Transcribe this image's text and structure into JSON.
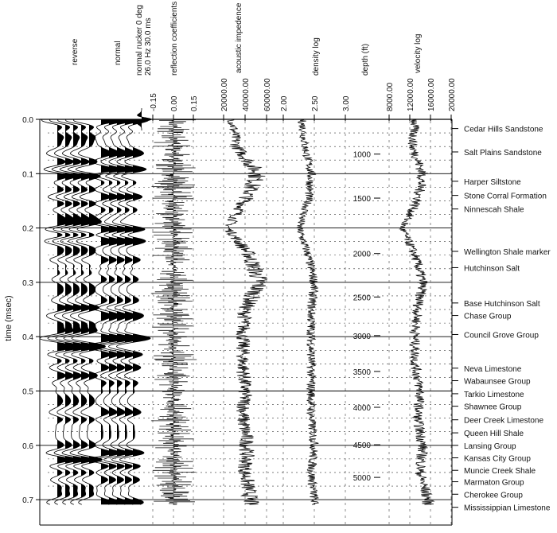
{
  "chart_data": {
    "type": "line",
    "ylabel": "time (msec)",
    "ylim": [
      0.0,
      0.72
    ],
    "time_ticks": [
      "0.0",
      "0.1",
      "0.2",
      "0.3",
      "0.4",
      "0.5",
      "0.6",
      "0.7"
    ],
    "columns": {
      "reverse": "reverse",
      "normal": "normal",
      "wavelet": [
        "normal rucker  0 deg",
        "26.0 Hz",
        "30.0 ms"
      ],
      "reflection": {
        "label": "reflection coefficients",
        "ticks": [
          "-0.15",
          "0.00",
          "0.15"
        ]
      },
      "impedance": {
        "label": "acoustic impedence",
        "ticks": [
          "20000.00",
          "40000.00",
          "60000.00"
        ]
      },
      "density": {
        "label": "density log",
        "ticks": [
          "2.00",
          "2.50",
          "3.00"
        ]
      },
      "depth": {
        "label": "depth (ft)",
        "ticks": [
          "1000",
          "1500",
          "2000",
          "2500",
          "3000",
          "3500",
          "4000",
          "4500",
          "5000"
        ],
        "times": [
          0.064,
          0.145,
          0.247,
          0.327,
          0.398,
          0.464,
          0.53,
          0.599,
          0.659
        ]
      },
      "velocity": {
        "label": "velocity log",
        "ticks": [
          "8000.00",
          "12000.00",
          "16000.00",
          "20000.00"
        ]
      }
    },
    "trend_time": [
      0,
      0.05,
      0.1,
      0.15,
      0.2,
      0.25,
      0.3,
      0.35,
      0.4,
      0.45,
      0.5,
      0.55,
      0.6,
      0.65,
      0.7
    ],
    "series": [
      {
        "name": "acoustic impedence",
        "values": [
          28000,
          32000,
          52000,
          40000,
          24000,
          44000,
          54000,
          40000,
          38000,
          38000,
          40000,
          38000,
          42000,
          40000,
          45000
        ]
      },
      {
        "name": "density log",
        "values": [
          2.3,
          2.35,
          2.45,
          2.4,
          2.25,
          2.4,
          2.5,
          2.45,
          2.45,
          2.45,
          2.45,
          2.45,
          2.5,
          2.45,
          2.5
        ]
      },
      {
        "name": "velocity log",
        "values": [
          13000,
          12500,
          14500,
          13500,
          10500,
          13000,
          14500,
          13500,
          13000,
          13000,
          14000,
          13500,
          14500,
          14000,
          15500
        ]
      }
    ],
    "formations": [
      {
        "name": "Cedar Hills Sandstone",
        "t": 0.017
      },
      {
        "name": "Salt Plains Sandstone",
        "t": 0.06
      },
      {
        "name": "Harper Siltstone",
        "t": 0.114
      },
      {
        "name": "Stone Corral Formation",
        "t": 0.14
      },
      {
        "name": "Ninnescah Shale",
        "t": 0.165
      },
      {
        "name": "Wellington Shale marker",
        "t": 0.243
      },
      {
        "name": "Hutchinson Salt",
        "t": 0.273
      },
      {
        "name": "Base Hutchinson Salt",
        "t": 0.338
      },
      {
        "name": "Chase Group",
        "t": 0.361
      },
      {
        "name": "Council Grove Group",
        "t": 0.396
      },
      {
        "name": "Neva Limestone",
        "t": 0.458
      },
      {
        "name": "Wabaunsee Group",
        "t": 0.481
      },
      {
        "name": "Tarkio Limestone",
        "t": 0.505
      },
      {
        "name": "Shawnee Group",
        "t": 0.528
      },
      {
        "name": "Deer Creek Limestone",
        "t": 0.553
      },
      {
        "name": "Queen Hill Shale",
        "t": 0.577
      },
      {
        "name": "Lansing Group",
        "t": 0.6
      },
      {
        "name": "Kansas City Group",
        "t": 0.623
      },
      {
        "name": "Muncie Creek Shale",
        "t": 0.646
      },
      {
        "name": "Marmaton Group",
        "t": 0.667
      },
      {
        "name": "Cherokee Group",
        "t": 0.69
      },
      {
        "name": "Mississippian Limestone",
        "t": 0.714
      }
    ]
  }
}
